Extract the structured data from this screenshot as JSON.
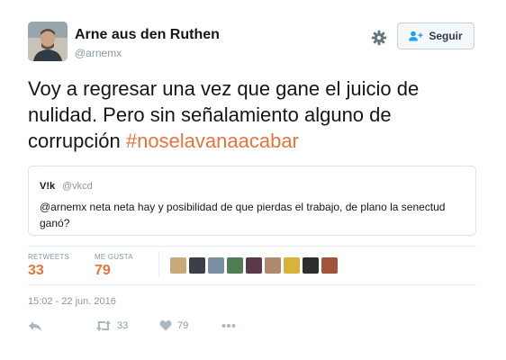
{
  "author": {
    "name": "Arne aus den Ruthen",
    "handle": "@arnemx"
  },
  "header": {
    "follow_label": "Seguir",
    "settings_icon": "gear-icon",
    "follow_icon": "add-user-icon"
  },
  "tweet": {
    "text": "Voy a regresar una vez que gane el juicio de nulidad. Pero sin señalamiento alguno de corrupción ",
    "hashtag": "#noselavanaacabar"
  },
  "quoted_tweet": {
    "name": "V!k",
    "handle": "@vkcd",
    "text": "@arnemx neta neta hay y posibilidad de que pierdas el trabajo, de plano la senectud ganó?"
  },
  "stats": {
    "retweets_label": "RETWEETS",
    "retweets_count": "33",
    "likes_label": "ME GUSTA",
    "likes_count": "79",
    "liker_avatars": [
      {
        "name": "liker-avatar-1",
        "color": "#c9a87a"
      },
      {
        "name": "liker-avatar-2",
        "color": "#3a3f4a"
      },
      {
        "name": "liker-avatar-3",
        "color": "#7a8fa0"
      },
      {
        "name": "liker-avatar-4",
        "color": "#4f7d55"
      },
      {
        "name": "liker-avatar-5",
        "color": "#5a3a4a"
      },
      {
        "name": "liker-avatar-6",
        "color": "#b08a70"
      },
      {
        "name": "liker-avatar-7",
        "color": "#d9b23a"
      },
      {
        "name": "liker-avatar-8",
        "color": "#2e2e2e"
      },
      {
        "name": "liker-avatar-9",
        "color": "#a0553a"
      }
    ]
  },
  "timestamp": "15:02 - 22 jun. 2016",
  "actions": {
    "reply_icon": "reply-icon",
    "retweet_icon": "retweet-icon",
    "retweet_count": "33",
    "like_icon": "heart-icon",
    "like_count": "79",
    "more_icon": "more-icon"
  },
  "colors": {
    "accent": "#e8743b",
    "muted": "#8899a6",
    "text": "#14171a",
    "border": "#e6ecf0"
  }
}
